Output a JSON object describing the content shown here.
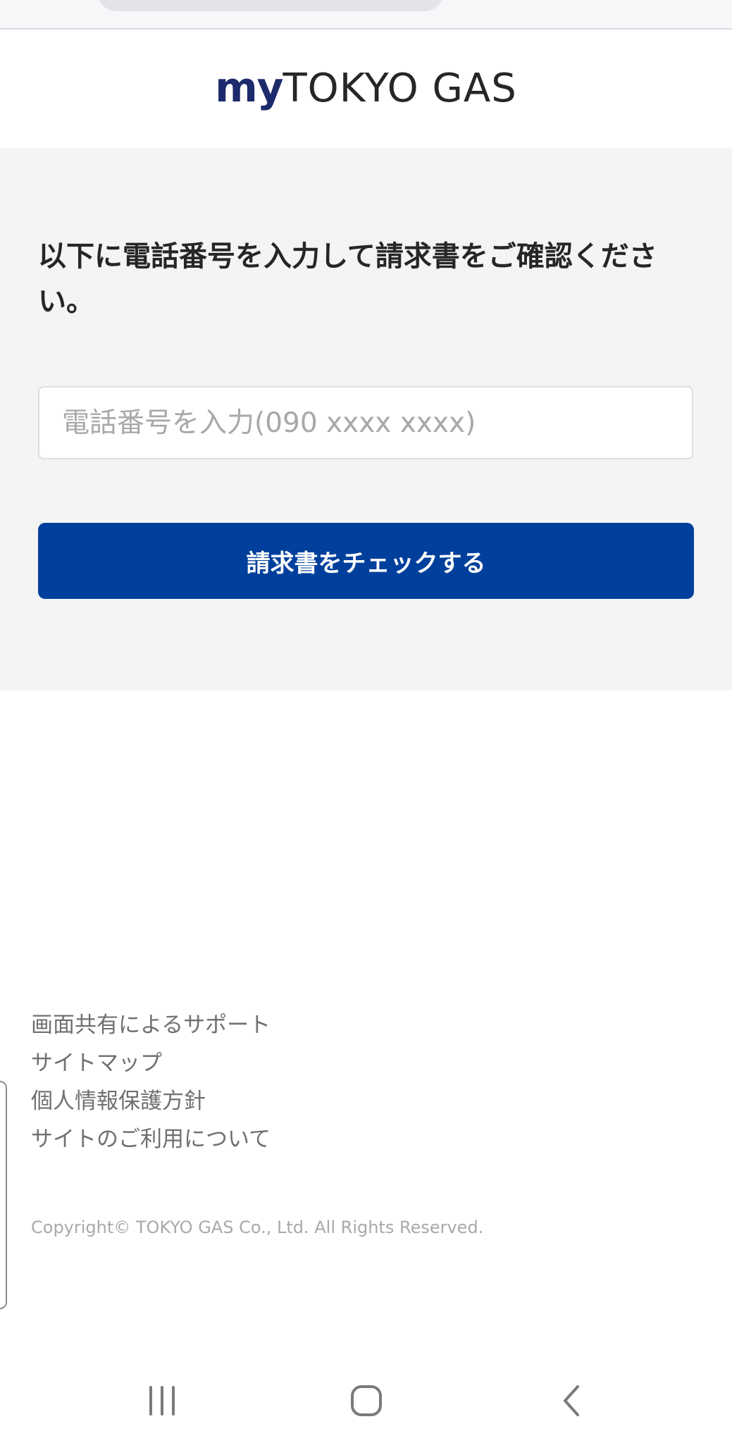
{
  "header": {
    "logo_my": "my",
    "logo_brand": "TOKYO GAS"
  },
  "main": {
    "instruction": "以下に電話番号を入力して請求書をご確認ください。",
    "phone_input": {
      "placeholder": "電話番号を入力(090 xxxx xxxx)",
      "value": ""
    },
    "check_button_label": "請求書をチェックする"
  },
  "footer": {
    "links": [
      "画面共有によるサポート",
      "サイトマップ",
      "個人情報保護方針",
      "サイトのご利用について"
    ],
    "copyright": "Copyright© TOKYO GAS Co., Ltd. All Rights Reserved."
  },
  "system_nav": {
    "icons": [
      "recent-apps-icon",
      "home-icon",
      "back-icon"
    ]
  },
  "colors": {
    "brand_navy": "#1d2a6b",
    "button_blue": "#00409c",
    "panel_gray": "#f4f4f4"
  }
}
